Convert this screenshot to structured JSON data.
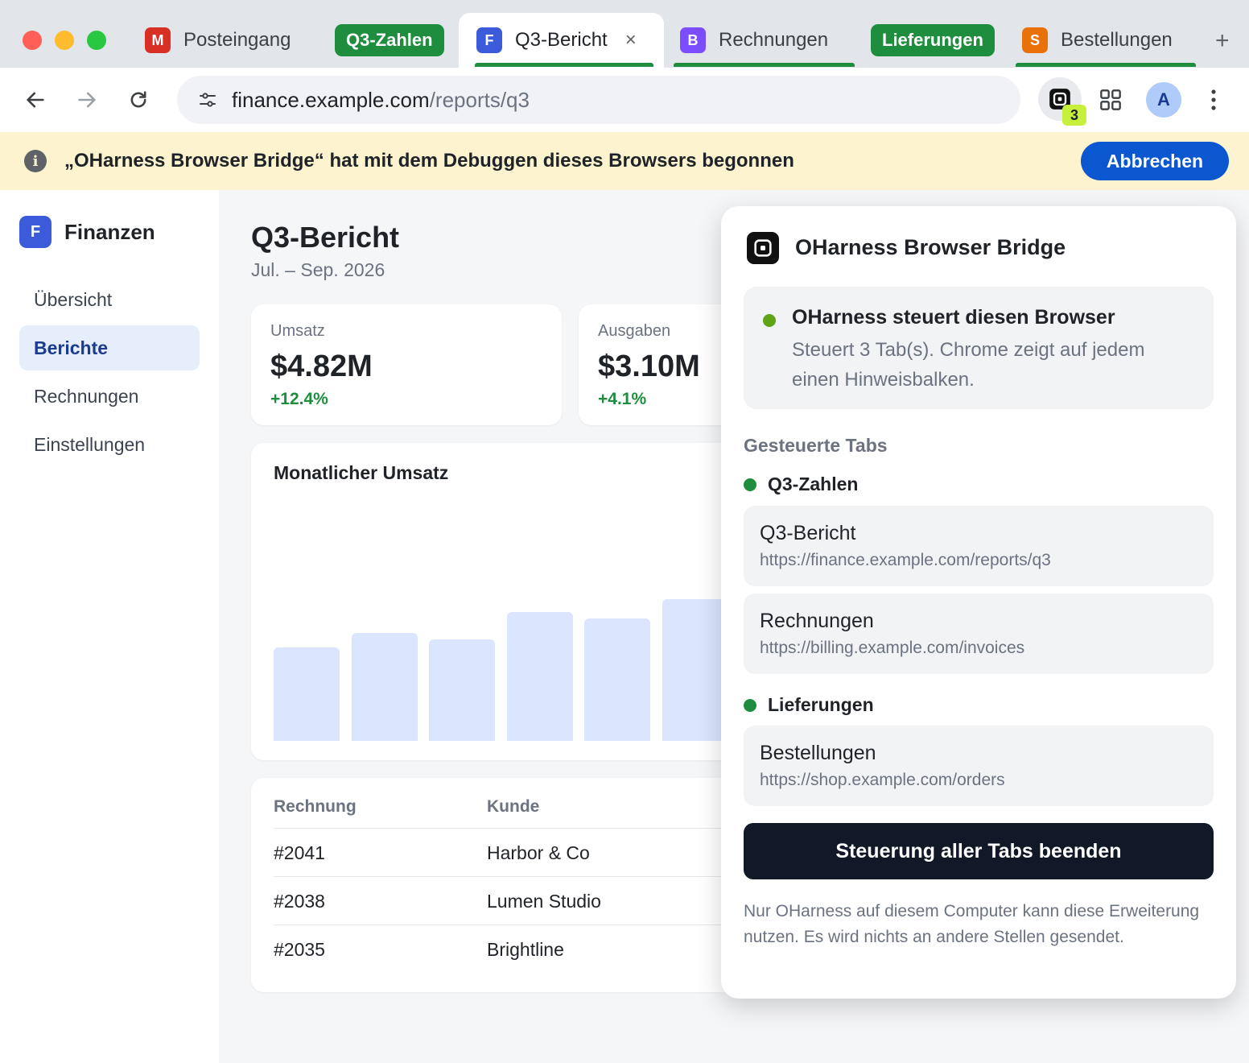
{
  "tabs": {
    "items": [
      {
        "label": "Posteingang",
        "favicon": "M",
        "color": "#d93025"
      },
      {
        "label": "Q3-Bericht",
        "favicon": "F",
        "color": "#3b5bdb"
      },
      {
        "label": "Rechnungen",
        "favicon": "B",
        "color": "#7c4dff"
      },
      {
        "label": "Bestellungen",
        "favicon": "S",
        "color": "#e8710a"
      }
    ],
    "groups": [
      {
        "label": "Q3-Zahlen",
        "color": "#1e8e3e"
      },
      {
        "label": "Lieferungen",
        "color": "#1e8e3e"
      }
    ],
    "close_symbol": "×",
    "new_tab_symbol": "+"
  },
  "toolbar": {
    "url_host": "finance.example.com",
    "url_path": "/reports/q3",
    "extension_badge": "3",
    "avatar_letter": "A"
  },
  "infobar": {
    "icon": "i",
    "message": "„OHarness Browser Bridge“ hat mit dem Debuggen dieses Browsers begonnen",
    "cancel_label": "Abbrechen"
  },
  "sidebar": {
    "brand_logo": "F",
    "brand_name": "Finanzen",
    "items": [
      {
        "label": "Übersicht",
        "active": false
      },
      {
        "label": "Berichte",
        "active": true
      },
      {
        "label": "Rechnungen",
        "active": false
      },
      {
        "label": "Einstellungen",
        "active": false
      }
    ]
  },
  "main": {
    "title": "Q3-Bericht",
    "subtitle": "Jul. – Sep. 2026",
    "kpis": [
      {
        "label": "Umsatz",
        "value": "$4.82M",
        "delta": "+12.4%"
      },
      {
        "label": "Ausgaben",
        "value": "$3.10M",
        "delta": "+4.1%"
      }
    ],
    "chart_title": "Monatlicher Umsatz",
    "table": {
      "headers": [
        "Rechnung",
        "Kunde"
      ],
      "rows": [
        [
          "#2041",
          "Harbor & Co"
        ],
        [
          "#2038",
          "Lumen Studio"
        ],
        [
          "#2035",
          "Brightline"
        ]
      ]
    }
  },
  "chart_data": {
    "type": "bar",
    "title": "Monatlicher Umsatz",
    "values": [
      0.58,
      0.67,
      0.63,
      0.8,
      0.76,
      0.88
    ],
    "note_scale": "relative heights, axis unlabeled",
    "color": "#dbe5fd"
  },
  "popup": {
    "title": "OHarness Browser Bridge",
    "status_head": "OHarness steuert diesen Browser",
    "status_desc": "Steuert 3 Tab(s). Chrome zeigt auf jedem einen Hinweisbalken.",
    "section_title": "Gesteuerte Tabs",
    "groups": [
      {
        "name": "Q3-Zahlen",
        "tabs": [
          {
            "title": "Q3-Bericht",
            "url": "https://finance.example.com/reports/q3"
          },
          {
            "title": "Rechnungen",
            "url": "https://billing.example.com/invoices"
          }
        ]
      },
      {
        "name": "Lieferungen",
        "tabs": [
          {
            "title": "Bestellungen",
            "url": "https://shop.example.com/orders"
          }
        ]
      }
    ],
    "stop_label": "Steuerung aller Tabs beenden",
    "footnote": "Nur OHarness auf diesem Computer kann diese Erweiterung nutzen. Es wird nichts an andere Stellen gesendet."
  }
}
